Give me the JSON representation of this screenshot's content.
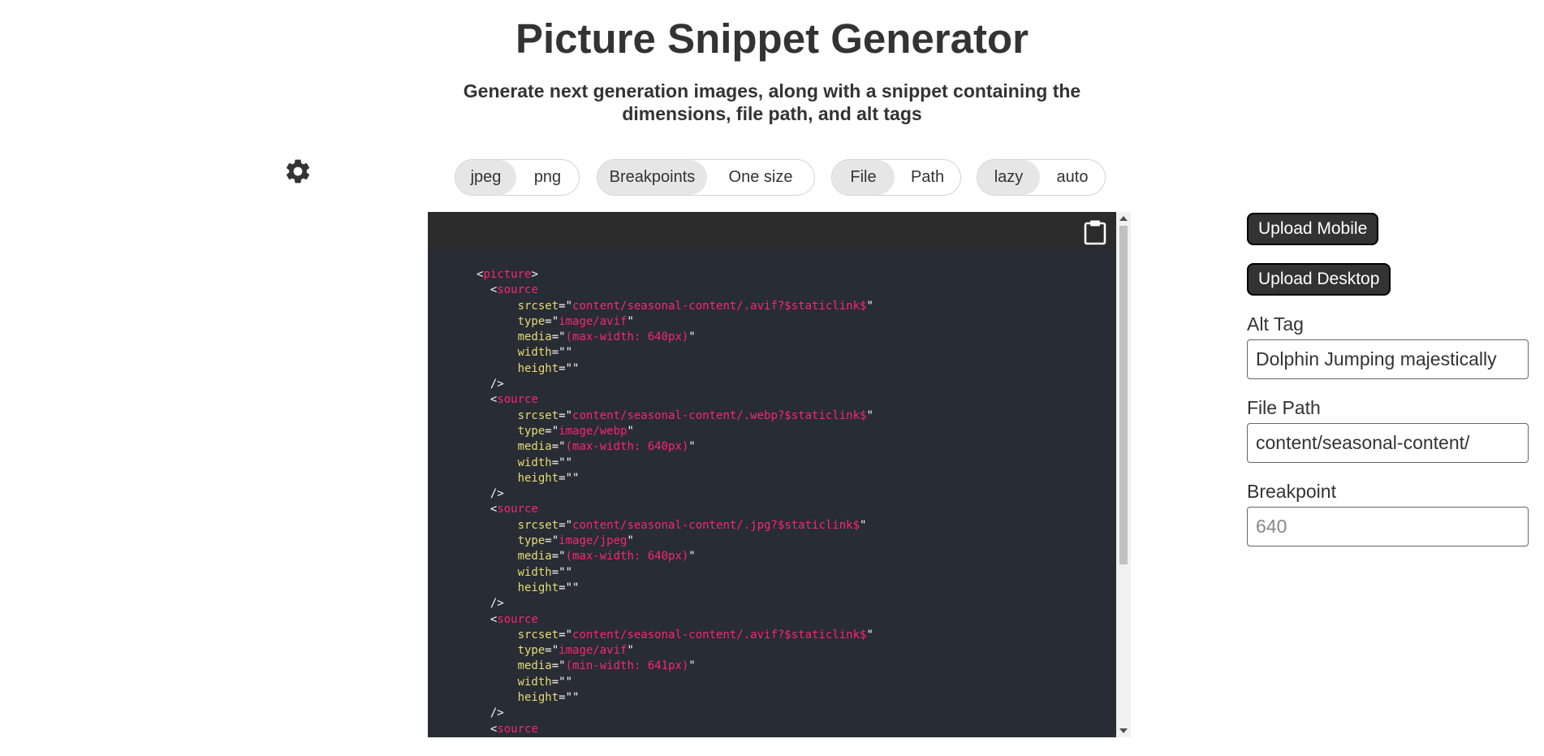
{
  "header": {
    "title": "Picture Snippet Generator",
    "subtitle": "Generate next generation images, along with a snippet containing the dimensions, file path, and alt tags"
  },
  "settings": {
    "icon": "gear-icon"
  },
  "toggles": {
    "format": {
      "options": [
        "jpeg",
        "png"
      ],
      "selected": "jpeg"
    },
    "sizing": {
      "options": [
        "Breakpoints",
        "One size"
      ],
      "selected": "Breakpoints"
    },
    "source": {
      "options": [
        "File",
        "Path"
      ],
      "selected": "File"
    },
    "loading": {
      "options": [
        "lazy",
        "auto"
      ],
      "selected": "lazy"
    }
  },
  "code": {
    "copy_icon": "clipboard-icon",
    "lines": [
      "<picture>",
      "  <source",
      "      srcset=\"content/seasonal-content/.avif?$staticlink$\"",
      "      type=\"image/avif\"",
      "      media=\"(max-width: 640px)\"",
      "      width=\"\"",
      "      height=\"\"",
      "  />",
      "  <source",
      "      srcset=\"content/seasonal-content/.webp?$staticlink$\"",
      "      type=\"image/webp\"",
      "      media=\"(max-width: 640px)\"",
      "      width=\"\"",
      "      height=\"\"",
      "  />",
      "  <source",
      "      srcset=\"content/seasonal-content/.jpg?$staticlink$\"",
      "      type=\"image/jpeg\"",
      "      media=\"(max-width: 640px)\"",
      "      width=\"\"",
      "      height=\"\"",
      "  />",
      "  <source",
      "      srcset=\"content/seasonal-content/.avif?$staticlink$\"",
      "      type=\"image/avif\"",
      "      media=\"(min-width: 641px)\"",
      "      width=\"\"",
      "      height=\"\"",
      "  />",
      "  <source"
    ]
  },
  "sidebar": {
    "upload_mobile": "Upload Mobile",
    "upload_desktop": "Upload Desktop",
    "alt_tag_label": "Alt Tag",
    "alt_tag_value": "Dolphin Jumping majestically",
    "file_path_label": "File Path",
    "file_path_value": "content/seasonal-content/",
    "breakpoint_label": "Breakpoint",
    "breakpoint_placeholder": "640"
  },
  "colors": {
    "code_bg": "#282c34",
    "code_tag": "#f92672",
    "code_attr": "#e6db74",
    "button_bg": "#333333",
    "toggle_active": "#e6e6e6"
  }
}
